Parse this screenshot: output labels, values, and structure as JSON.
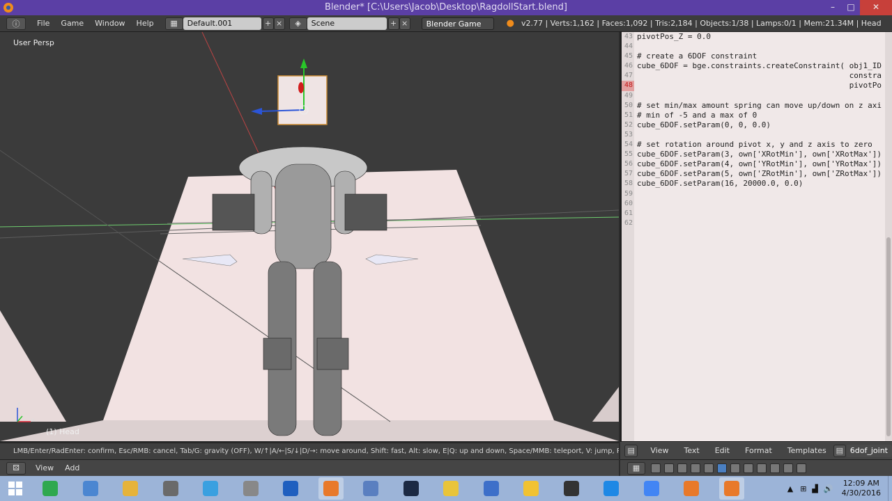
{
  "window": {
    "title": "Blender* [C:\\Users\\Jacob\\Desktop\\RagdollStart.blend]",
    "min_glyph": "–",
    "max_glyph": "□",
    "close_glyph": "✕"
  },
  "info_header": {
    "menus": [
      "File",
      "Game",
      "Window",
      "Help"
    ],
    "screen_layout": "Default.001",
    "scene": "Scene",
    "engine": "Blender Game",
    "stats": "v2.77 | Verts:1,162 | Faces:1,092 | Tris:2,184 | Objects:1/38 | Lamps:0/1 | Mem:21.34M | Head"
  },
  "viewport": {
    "view_label": "User Persp",
    "object_label": "(1) Head",
    "axis_x": "x",
    "axis_z": "z"
  },
  "status_line": "LMB/Enter/RadEnter: confirm, Esc/RMB: cancel, Tab/G: gravity (OFF), W/↑|A/←|S/↓|D/→: move around, Shift: fast, Alt: slow, E|Q: up and down, Space/MMB: teleport, V: jump, Pad+/WhUp:",
  "viewport_header": {
    "menus": [
      "View",
      "Add"
    ]
  },
  "text_editor": {
    "highlight_line": "48",
    "lines": [
      {
        "n": "43",
        "code": "pivotPos_Z = 0.0"
      },
      {
        "n": "44",
        "code": ""
      },
      {
        "n": "45",
        "code": "# create a 6DOF constraint"
      },
      {
        "n": "46",
        "code": "cube_6DOF = bge.constraints.createConstraint( obj1_ID"
      },
      {
        "n": "47",
        "code": "                                              constra"
      },
      {
        "n": "48",
        "code": "                                              pivotPo"
      },
      {
        "n": "49",
        "code": ""
      },
      {
        "n": "50",
        "code": "# set min/max amount spring can move up/down on z axi"
      },
      {
        "n": "51",
        "code": "# min of -5 and a max of 0"
      },
      {
        "n": "52",
        "code": "cube_6DOF.setParam(0, 0, 0.0)"
      },
      {
        "n": "53",
        "code": ""
      },
      {
        "n": "54",
        "code": "# set rotation around pivot x, y and z axis to zero"
      },
      {
        "n": "55",
        "code": "cube_6DOF.setParam(3, own['XRotMin'], own['XRotMax'])"
      },
      {
        "n": "56",
        "code": "cube_6DOF.setParam(4, own['YRotMin'], own['YRotMax'])"
      },
      {
        "n": "57",
        "code": "cube_6DOF.setParam(5, own['ZRotMin'], own['ZRotMax'])"
      },
      {
        "n": "58",
        "code": "cube_6DOF.setParam(16, 20000.0, 0.0)"
      },
      {
        "n": "59",
        "code": ""
      },
      {
        "n": "60",
        "code": ""
      },
      {
        "n": "61",
        "code": ""
      },
      {
        "n": "62",
        "code": ""
      }
    ],
    "header_menus": [
      "View",
      "Text",
      "Edit",
      "Format",
      "Templates"
    ],
    "text_name": "6dof_joint"
  },
  "taskbar": {
    "apps": [
      "sheets-icon",
      "notepad-icon",
      "paint-icon",
      "calc-icon",
      "drive-icon",
      "printer-icon",
      "ie-icon",
      "blender-icon",
      "cloud-icon",
      "steam-icon",
      "folder-icon",
      "monitor-icon",
      "fallout-icon",
      "obs-icon",
      "clock-app-icon",
      "chrome-icon",
      "blender-icon-2",
      "blender-icon-3"
    ],
    "time": "12:09 AM",
    "date": "4/30/2016"
  },
  "colors": {
    "titlebar": "#5b3fa5",
    "close": "#c7403a",
    "taskbar": "#9cb4d8",
    "editor_bg": "#f0e8e8",
    "highlight": "#c21a1a"
  }
}
